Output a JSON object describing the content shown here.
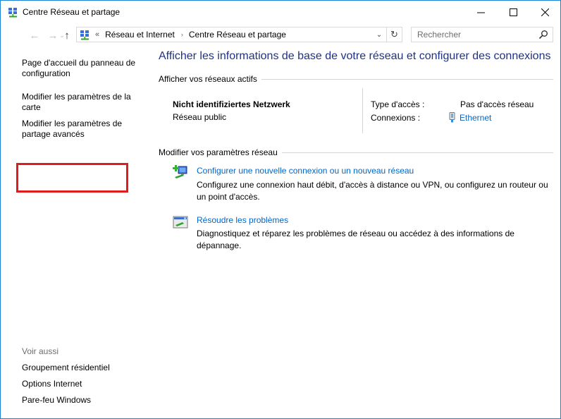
{
  "window": {
    "title": "Centre Réseau et partage",
    "controls": {
      "minimize": "—",
      "maximize": "☐",
      "close": "✕"
    }
  },
  "navigation": {
    "back": "←",
    "forward": "→",
    "recent": "⌄",
    "up": "↑",
    "address_prefix": "«",
    "breadcrumbs": [
      "Réseau et Internet",
      "Centre Réseau et partage"
    ],
    "separator": "›",
    "dropdown": "⌄",
    "refresh": "↻",
    "search_placeholder": "Rechercher"
  },
  "sidebar": {
    "links": [
      "Page d'accueil du panneau de configuration",
      "Modifier les paramètres de la carte",
      "Modifier les paramètres de partage avancés"
    ],
    "highlighted_index": 2,
    "highlight_color": "#e21c1c",
    "see_also_title": "Voir aussi",
    "see_also": [
      "Groupement résidentiel",
      "Options Internet",
      "Pare-feu Windows"
    ]
  },
  "main": {
    "heading": "Afficher les informations de base de votre réseau et configurer des connexions",
    "active_networks_title": "Afficher vos réseaux actifs",
    "network": {
      "name": "Nicht identifiziertes Netzwerk",
      "type": "Réseau public",
      "access_label": "Type d'accès :",
      "access_value": "Pas d'accès réseau",
      "connections_label": "Connexions :",
      "connection_value": "Ethernet"
    },
    "change_settings_title": "Modifier vos paramètres réseau",
    "tasks": [
      {
        "link": "Configurer une nouvelle connexion ou un nouveau réseau",
        "description": "Configurez une connexion haut débit, d'accès à distance ou VPN, ou configurez un routeur ou un point d'accès."
      },
      {
        "link": "Résoudre les problèmes",
        "description": "Diagnostiquez et réparez les problèmes de réseau ou accédez à des informations de dépannage."
      }
    ]
  },
  "colors": {
    "heading": "#1e3287",
    "link": "#0066cc",
    "border": "#1883d7"
  }
}
